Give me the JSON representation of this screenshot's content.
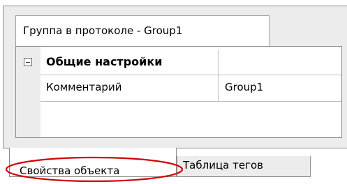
{
  "top_tab": {
    "label": "Группа в протоколе - Group1"
  },
  "property_grid": {
    "category": {
      "label": "Общие настройки"
    },
    "rows": [
      {
        "name": "Комментарий",
        "value": "Group1"
      }
    ]
  },
  "bottom_tabs": [
    {
      "label": "Свойства объекта",
      "selected": true
    },
    {
      "label": "Таблица тегов",
      "selected": false
    }
  ],
  "colors": {
    "highlight_ellipse": "#d40000",
    "panel_background": "#ececec",
    "border": "#8c8c8c"
  }
}
